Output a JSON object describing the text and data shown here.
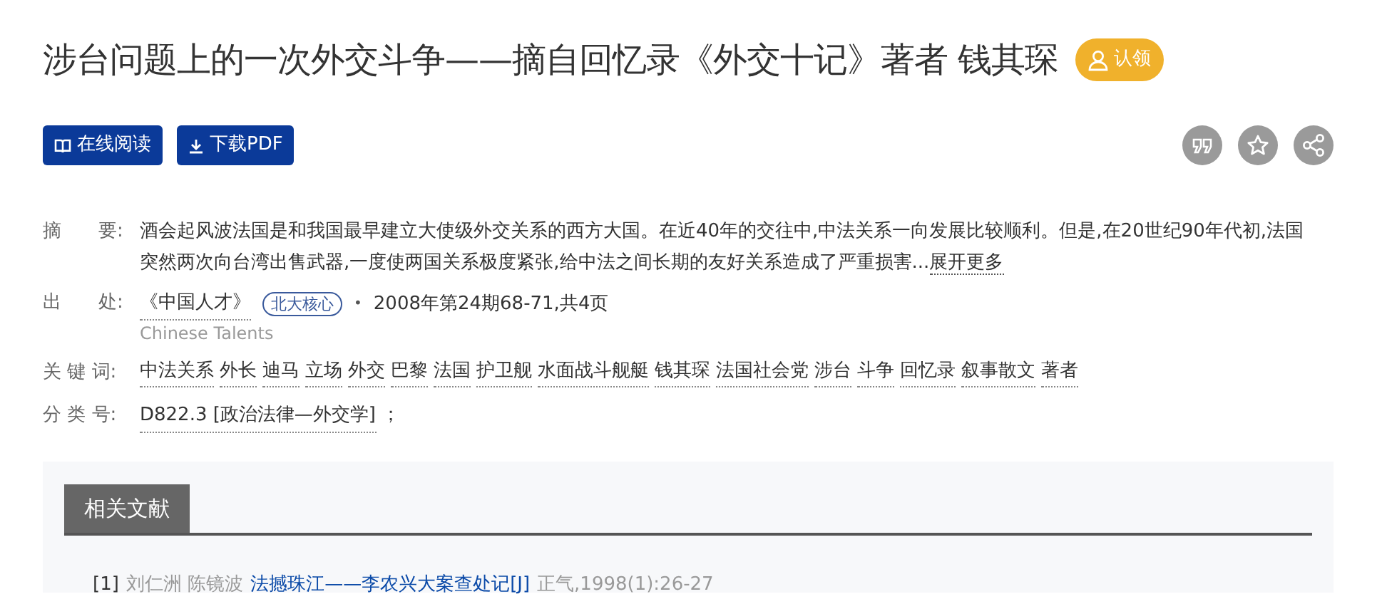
{
  "title": "涉台问题上的一次外交斗争——摘自回忆录《外交十记》著者 钱其琛",
  "claim_badge": "认领",
  "actions": [
    {
      "label": "在线阅读",
      "kind": "read"
    },
    {
      "label": "下载PDF",
      "kind": "download"
    }
  ],
  "tools": [
    {
      "kind": "quote"
    },
    {
      "kind": "star"
    },
    {
      "kind": "share"
    }
  ],
  "abstract": {
    "label": "摘　　要:",
    "text": "酒会起风波法国是和我国最早建立大使级外交关系的西方大国。在近40年的交往中,中法关系一向发展比较顺利。但是,在20世纪90年代初,法国突然两次向台湾出售武器,一度使两国关系极度紧张,给中法之间长期的友好关系造成了严重损害...",
    "more": "展开更多"
  },
  "source": {
    "label": "出　　处:",
    "journal": "《中国人才》",
    "journal_en": "Chinese Talents",
    "tag": "北大核心",
    "separator": "•",
    "issue": "2008年第24期68-71,共4页"
  },
  "keywords": {
    "label": "关 键 词:",
    "items": [
      "中法关系",
      "外长",
      "迪马",
      "立场",
      "外交",
      "巴黎",
      "法国",
      "护卫舰",
      "水面战斗舰艇",
      "钱其琛",
      "法国社会党",
      "涉台",
      "斗争",
      "回忆录",
      "叙事散文",
      "著者"
    ]
  },
  "classification": {
    "label": "分 类 号:",
    "code": "D822.3 [政治法律—外交学]",
    "suffix": "；"
  },
  "related": {
    "tab": "相关文献",
    "items": [
      {
        "index": "[1]",
        "authors": "刘仁洲 陈镜波",
        "title": "法撼珠江——李农兴大案查处记[J]",
        "source": "正气,1998(1):26-27"
      }
    ]
  }
}
